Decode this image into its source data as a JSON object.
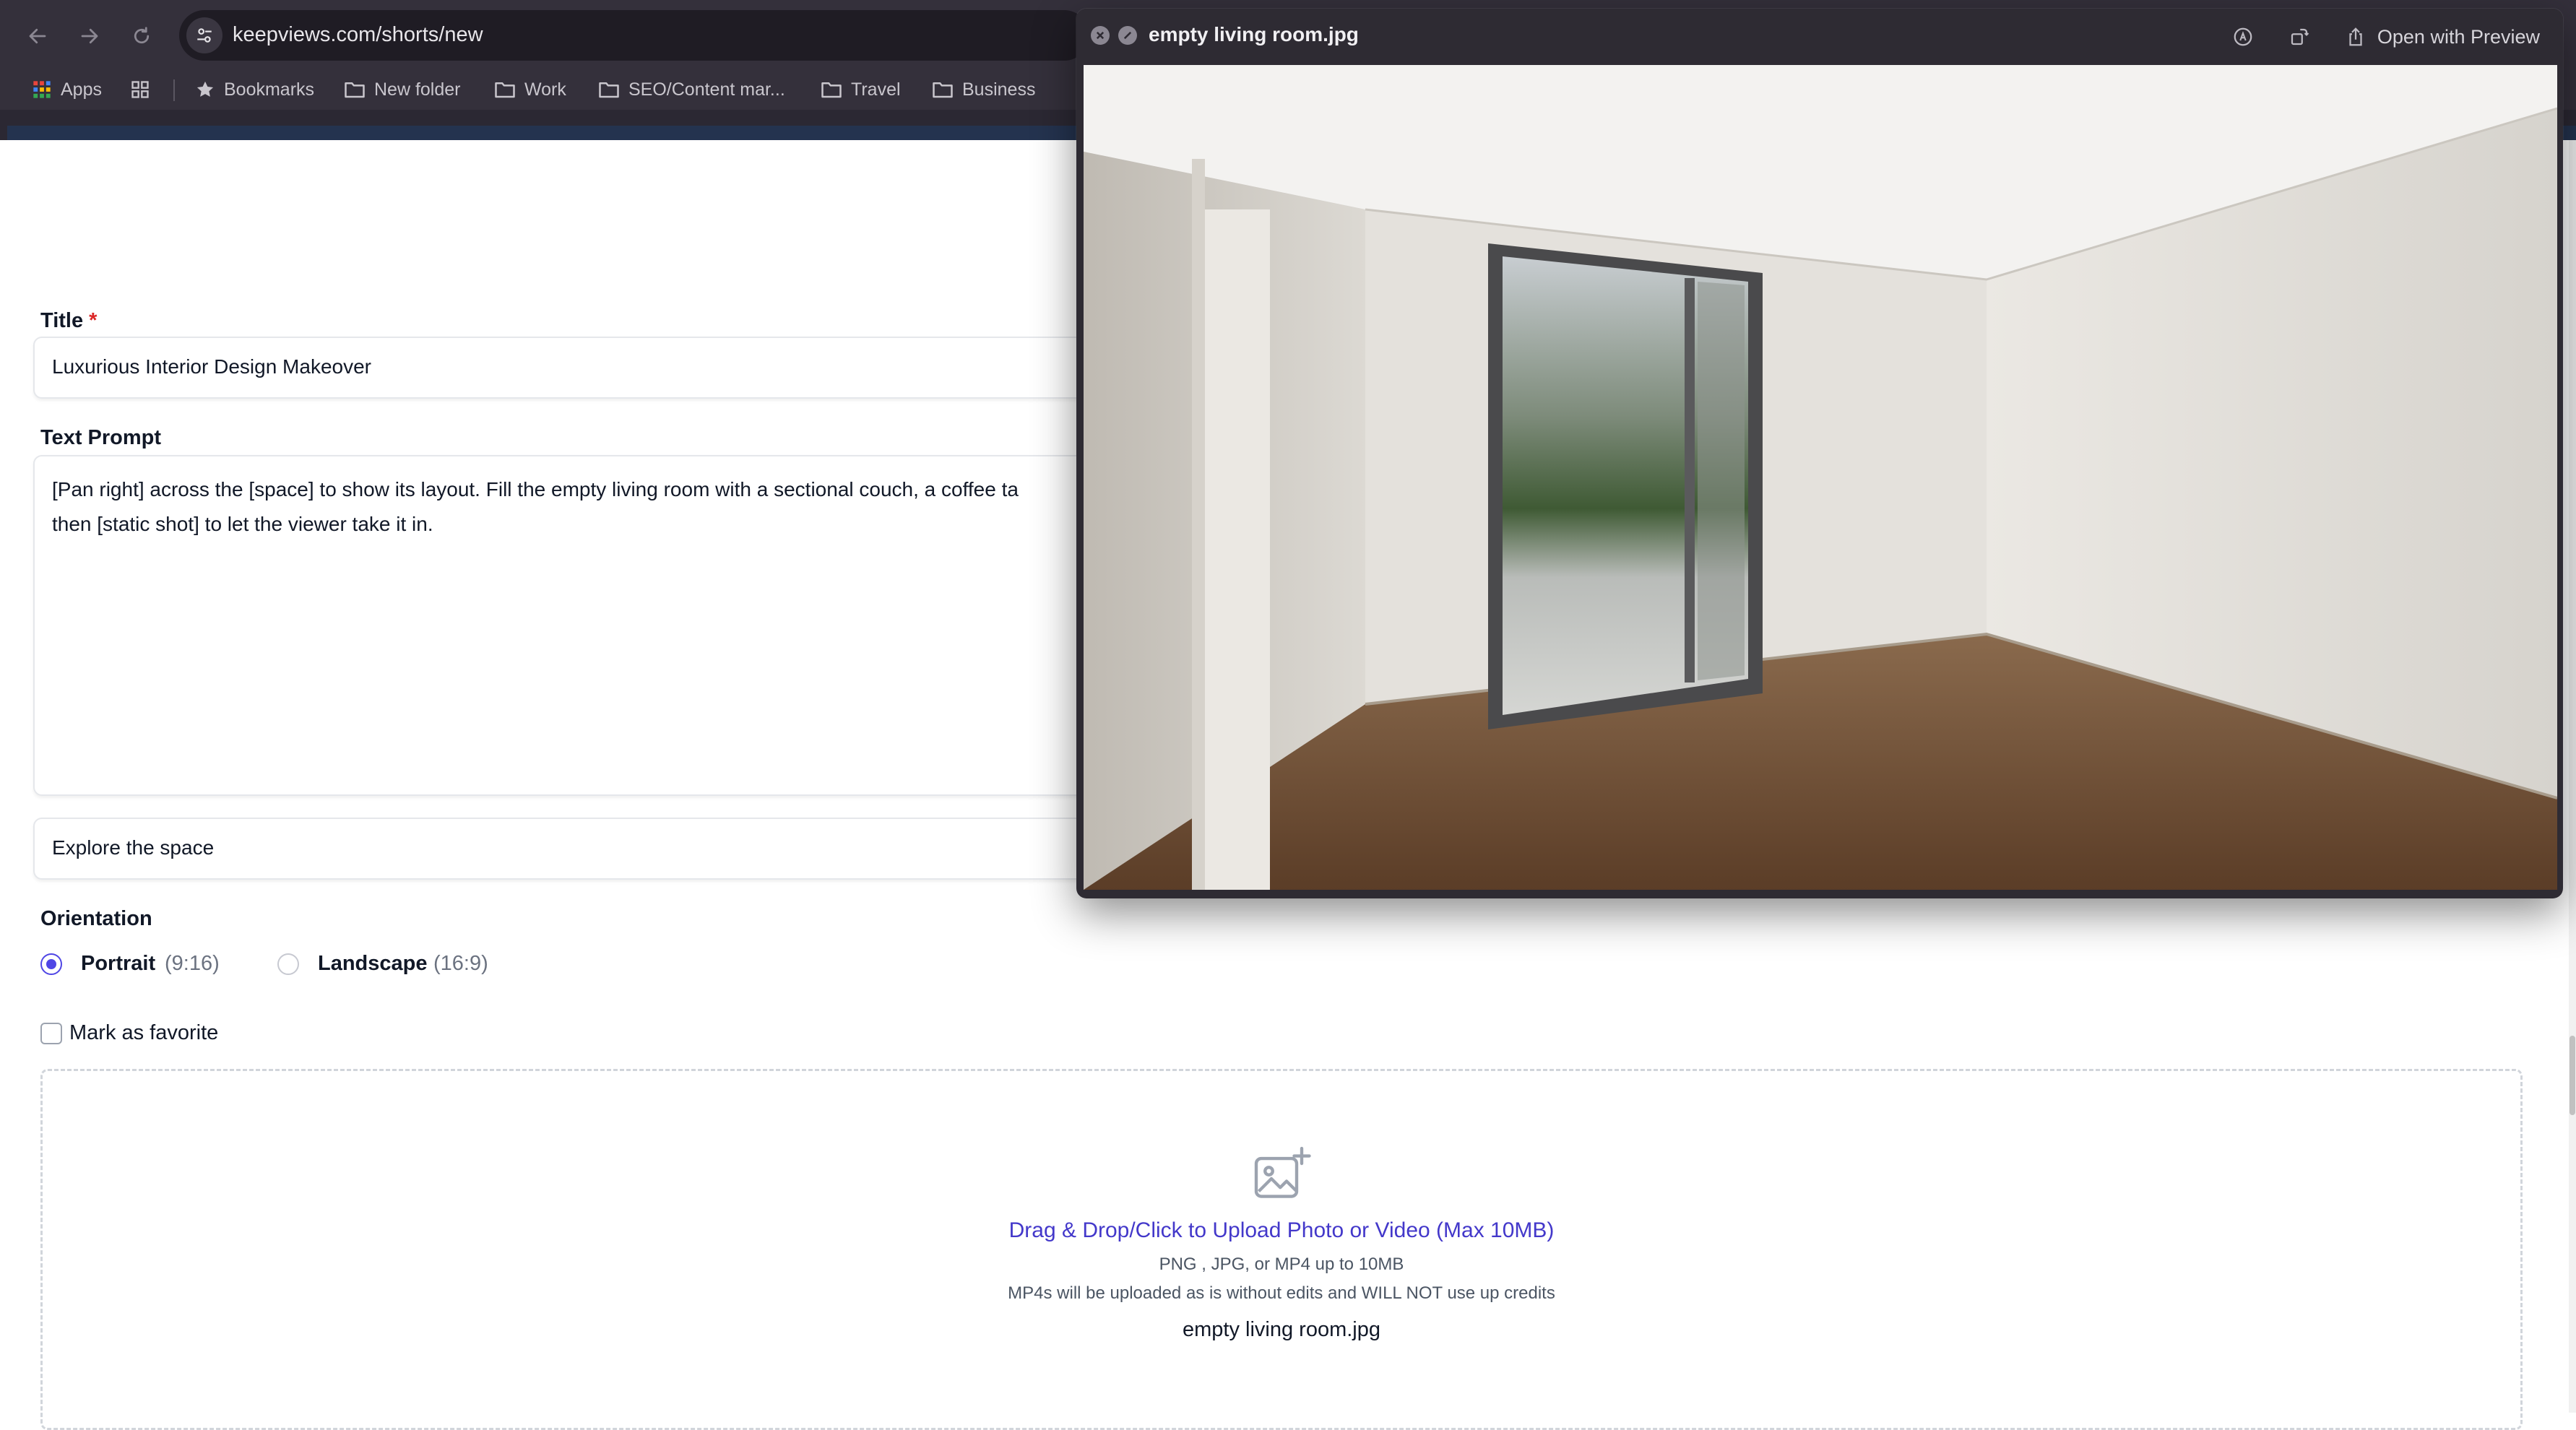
{
  "browser": {
    "url": "keepviews.com/shorts/new",
    "bookmarks": [
      "Apps",
      "Bookmarks",
      "New folder",
      "Work",
      "SEO/Content mar...",
      "Travel",
      "Business"
    ]
  },
  "icons": {
    "back": "arrow-left-icon",
    "forward": "arrow-right-icon",
    "reload": "reload-icon",
    "site_settings": "tune-icon",
    "apps": "grid-icon",
    "bookmarks": "star-icon",
    "folder": "folder-icon",
    "upload": "image-plus-icon"
  },
  "form": {
    "title_label": "Title",
    "required_mark": "*",
    "title_value": "Luxurious Interior Design Makeover",
    "prompt_label": "Text Prompt",
    "prompt_line1": "[Pan right] across the [space] to show its layout. Fill the empty living room with a sectional couch, a coffee ta",
    "prompt_line2": "then [static shot] to let the viewer take it in.",
    "style_value": "Explore the space",
    "orientation_label": "Orientation",
    "orientation_options": [
      {
        "label": "Portrait",
        "ratio": "(9:16)",
        "selected": true
      },
      {
        "label": "Landscape",
        "ratio": "(16:9)",
        "selected": false
      }
    ],
    "favorite_label": "Mark as favorite",
    "favorite_checked": false
  },
  "upload": {
    "cta": "Drag & Drop/Click to Upload Photo or Video (Max 10MB)",
    "formats": "PNG , JPG, or MP4 up to 10MB",
    "note": "MP4s will be uploaded as is without edits and WILL NOT use up credits",
    "filename": "empty living room.jpg"
  },
  "quicklook": {
    "title": "empty living room.jpg",
    "open_button": "Open with Preview"
  },
  "colors": {
    "accent": "#4f46e5",
    "link": "#4338ca",
    "required": "#dc2626",
    "chrome": "#34303b"
  }
}
